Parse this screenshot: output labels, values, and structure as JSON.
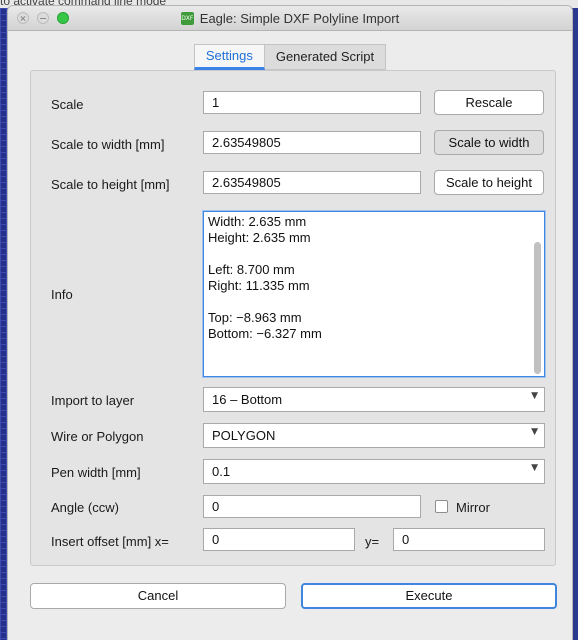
{
  "background": {
    "hint_text": "to activate command line mode"
  },
  "window": {
    "title": "Eagle: Simple DXF Polyline Import",
    "app_icon_text": "DXF"
  },
  "tabs": [
    {
      "label": "Settings",
      "active": true
    },
    {
      "label": "Generated Script",
      "active": false
    }
  ],
  "form": {
    "scale": {
      "label": "Scale",
      "value": "1",
      "button": "Rescale"
    },
    "scale_to_width": {
      "label": "Scale to width [mm]",
      "value": "2.63549805",
      "button": "Scale to width"
    },
    "scale_to_height": {
      "label": "Scale to height [mm]",
      "value": "2.63549805",
      "button": "Scale to height"
    },
    "info": {
      "label": "Info",
      "lines": [
        "Width: 2.635 mm",
        "Height: 2.635 mm",
        "",
        "Left: 8.700 mm",
        "Right: 11.335 mm",
        "",
        "Top: −8.963 mm",
        "Bottom: −6.327 mm"
      ]
    },
    "import_to_layer": {
      "label": "Import to layer",
      "selected": "16 – Bottom"
    },
    "wire_or_polygon": {
      "label": "Wire or Polygon",
      "selected": "POLYGON"
    },
    "pen_width": {
      "label": "Pen width [mm]",
      "selected": "0.1"
    },
    "angle": {
      "label": "Angle (ccw)",
      "value": "0",
      "mirror_label": "Mirror",
      "mirror_checked": false
    },
    "insert_offset": {
      "label": "Insert offset [mm] x=",
      "x_value": "0",
      "y_label": "y=",
      "y_value": "0"
    }
  },
  "buttons": {
    "cancel": "Cancel",
    "execute": "Execute"
  },
  "colors": {
    "accent": "#3a82e6",
    "close_button": "#dcdcdc",
    "maximize_button": "#37c646"
  }
}
